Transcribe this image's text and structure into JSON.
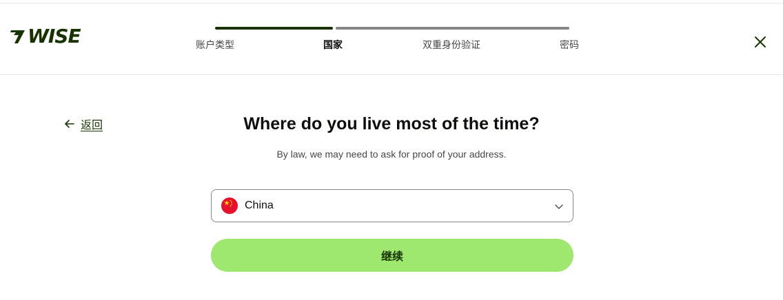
{
  "brand": {
    "name": "WISE",
    "color": "#163300",
    "accent": "#9fe870"
  },
  "stepper": {
    "steps": [
      {
        "label": "账户类型",
        "state": "done"
      },
      {
        "label": "国家",
        "state": "active"
      },
      {
        "label": "双重身份验证",
        "state": "todo"
      },
      {
        "label": "密码",
        "state": "todo"
      }
    ]
  },
  "header": {
    "close_icon": "close-icon"
  },
  "back": {
    "label": "返回",
    "icon": "arrow-left-icon"
  },
  "main": {
    "title": "Where do you live most of the time?",
    "subtitle": "By law, we may need to ask for proof of your address."
  },
  "country_select": {
    "value": "China",
    "flag_icon": "china-flag-icon",
    "chevron_icon": "chevron-down-icon"
  },
  "continue_button": {
    "label": "继续"
  }
}
